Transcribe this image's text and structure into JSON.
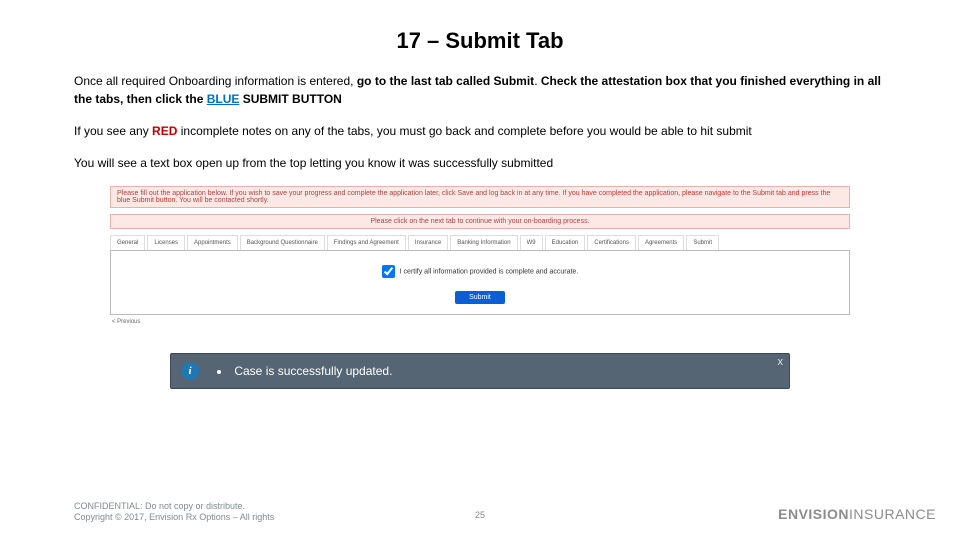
{
  "title": "17 – Submit Tab",
  "para1": {
    "pre": "Once all required Onboarding information is entered, ",
    "bold1": "go to the last tab called Submit",
    "mid": ".  ",
    "bold2": "Check the attestation box that you finished everything in all the tabs, then click the ",
    "blue": "BLUE",
    "bold3": " SUBMIT BUTTON"
  },
  "para2": {
    "pre": "If you see any ",
    "red": "RED",
    "post": " incomplete notes on any of the tabs, you must go back and complete before you would be able to hit submit"
  },
  "para3": "You will see a text box open up from the top letting you know it was successfully  submitted",
  "shot": {
    "banner1_a": "Please fill out the application below. If you wish to save your progress and complete the application later, click Save and log back in at any time. ",
    "banner1_b": "If you have completed the application, please navigate to the Submit tab and press the blue Submit button. ",
    "banner1_c": "You will be contacted shortly.",
    "banner2": "Please click on the next tab to continue with your on-boarding process.",
    "tabs": [
      "General",
      "Licenses",
      "Appointments",
      "Background Questionnaire",
      "Findings and Agreement",
      "Insurance",
      "Banking Information",
      "W9",
      "Education",
      "Certifications",
      "Agreements",
      "Submit"
    ],
    "attest": "I certify all information provided is complete and accurate.",
    "submit": "Submit",
    "prev": "< Previous"
  },
  "toast": {
    "message": "Case is successfully updated.",
    "info": "i",
    "close": "x"
  },
  "footer": {
    "l1": "CONFIDENTIAL: Do not copy or distribute.",
    "l2": "Copyright © 2017, Envision Rx Options – All rights"
  },
  "page": "25",
  "brand": {
    "a": "ENVISION",
    "b": "INSURANCE"
  }
}
